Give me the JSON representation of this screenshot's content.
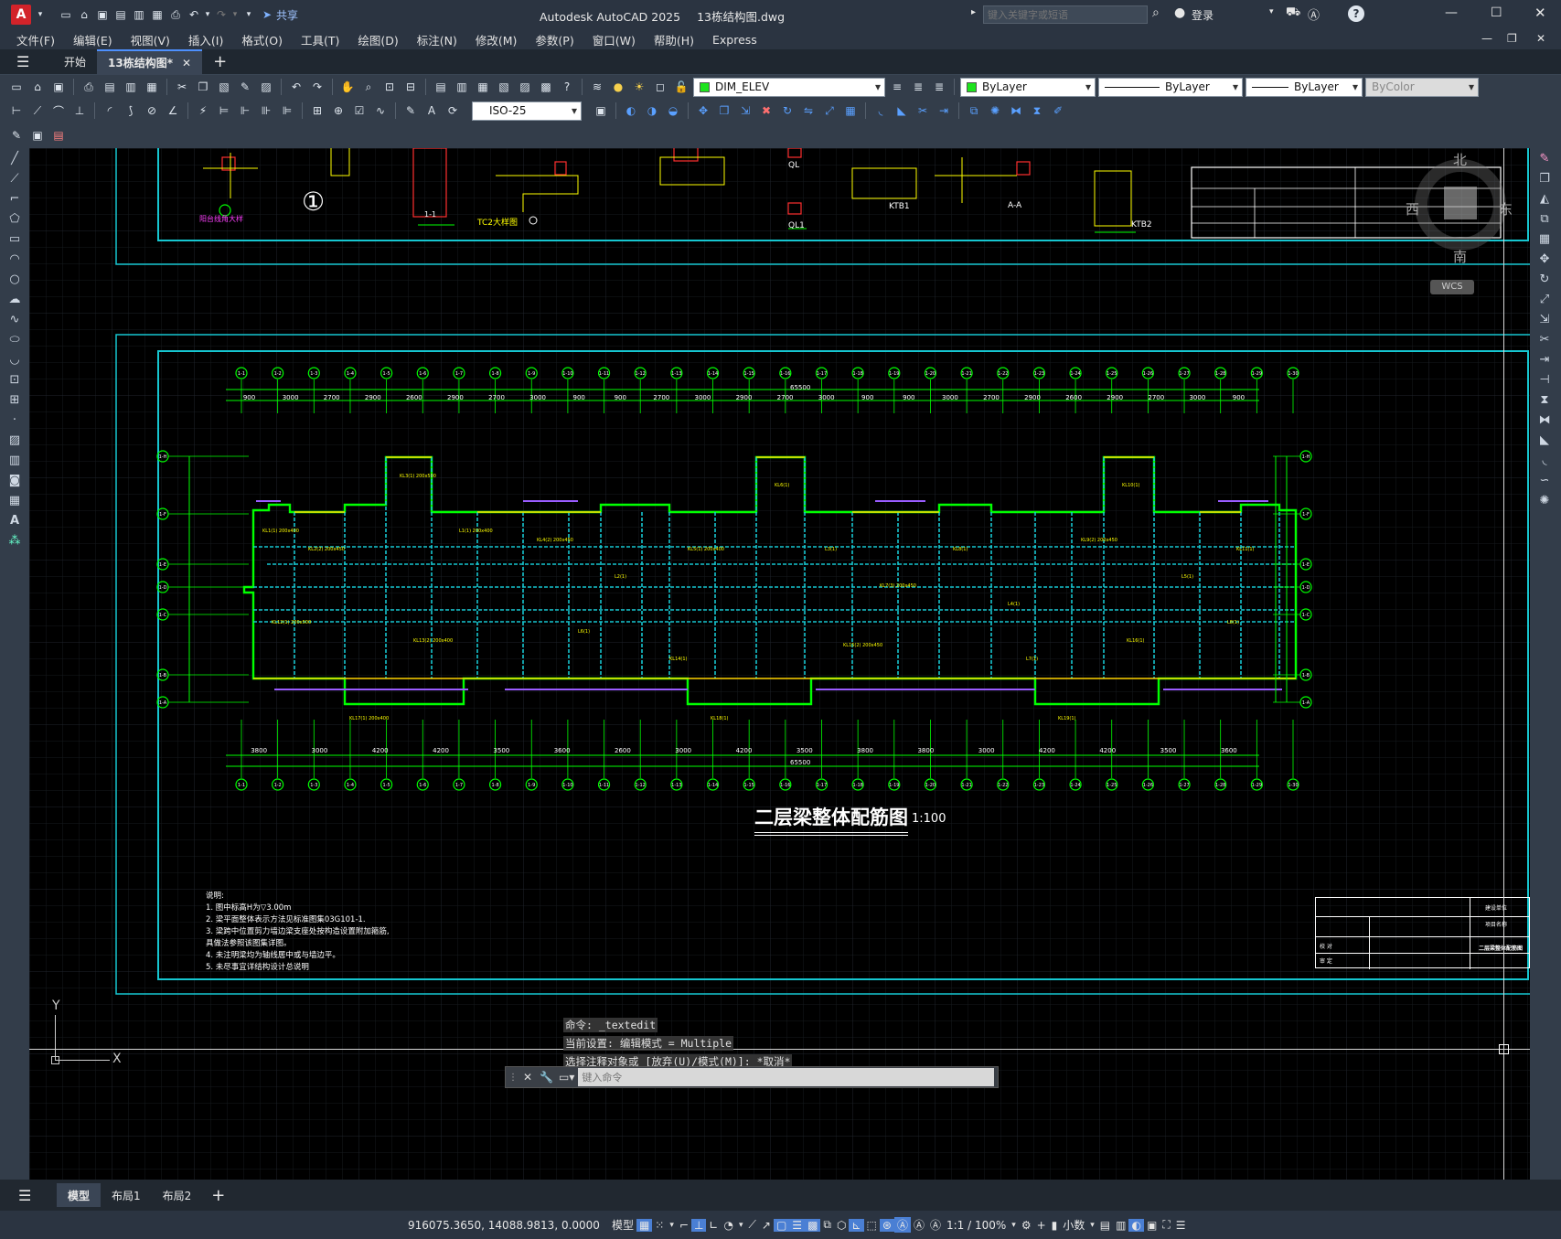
{
  "window": {
    "app_badge": "A",
    "title": "Autodesk AutoCAD 2025",
    "file": "13栋结构图.dwg",
    "search_placeholder": "键入关键字或短语",
    "login": "登录",
    "share": "共享"
  },
  "menu": [
    "文件(F)",
    "编辑(E)",
    "视图(V)",
    "插入(I)",
    "格式(O)",
    "工具(T)",
    "绘图(D)",
    "标注(N)",
    "修改(M)",
    "参数(P)",
    "窗口(W)",
    "帮助(H)",
    "Express"
  ],
  "tabs": {
    "start": "开始",
    "active": "13栋结构图*"
  },
  "toolbar": {
    "layer": "DIM_ELEV",
    "color": "ByLayer",
    "linetype": "ByLayer",
    "lineweight": "ByLayer",
    "plotstyle": "ByColor",
    "dimstyle": "ISO-25"
  },
  "drawing": {
    "title": "二层梁整体配筋图",
    "scale": "1:100",
    "total_dim": "65500",
    "notes_title": "说明:",
    "notes": [
      "1. 图中标高H为▽3.00m",
      "2. 梁平面整体表示方法见标准图集03G101-1.",
      "3. 梁跨中位置剪力墙边梁支座处按构造设置附加箍筋,",
      "   具做法参照该图集详图。",
      "4. 未注明梁均为轴线居中或与墙边平。",
      "5. 未尽事宜详结构设计总说明"
    ],
    "top_dims": [
      "900",
      "3000",
      "2700",
      "2900",
      "2600",
      "2900",
      "2700",
      "3000",
      "900",
      "900",
      "2700",
      "3000",
      "2900",
      "2700",
      "3000",
      "900",
      "900",
      "3000",
      "2700",
      "2900",
      "2600",
      "2900",
      "2700",
      "3000",
      "900"
    ],
    "bottom_dims": [
      "3800",
      "3000",
      "4200",
      "4200",
      "3500",
      "3600",
      "2600",
      "3000",
      "4200",
      "3500",
      "3800",
      "3800",
      "3000",
      "4200",
      "4200",
      "3500",
      "3600"
    ],
    "axis_top": [
      "1-1",
      "1-2",
      "1-3",
      "1-4",
      "1-5",
      "1-6",
      "1-7",
      "1-8",
      "1-9",
      "1-10",
      "1-11",
      "1-12",
      "1-13",
      "1-14",
      "1-15",
      "1-16",
      "1-17",
      "1-18",
      "1-19",
      "1-20",
      "1-21",
      "1-22",
      "1-23",
      "1-24",
      "1-25",
      "1-26",
      "1-27",
      "1-28",
      "1-29",
      "1-30"
    ],
    "axis_left": [
      "1-H",
      "1-F",
      "1-E",
      "1-D",
      "1-C",
      "1-B",
      "1-A"
    ],
    "labels_top": [
      "①",
      "阳台线角大样",
      "TC2大样图",
      "KTB1",
      "KTB2",
      "A-A",
      "QL",
      "QL1",
      "1-1"
    ],
    "compass": {
      "n": "北",
      "s": "南",
      "e": "东",
      "w": "西",
      "wcs": "WCS"
    },
    "ucs": {
      "y": "Y",
      "x": "X"
    },
    "titleblock": {
      "row1": "建设单位",
      "row2": "项目名称",
      "row3": "校 对",
      "row4": "审 定",
      "sheet": "二层梁整体配筋图"
    }
  },
  "command": {
    "line1": "命令: _textedit",
    "line2": "当前设置: 编辑模式 = Multiple",
    "line3": "选择注释对象或 [放弃(U)/模式(M)]: *取消*",
    "placeholder": "键入命令"
  },
  "layouts": [
    "模型",
    "布局1",
    "布局2"
  ],
  "status": {
    "coords": "916075.3650, 14088.9813, 0.0000",
    "mode": "模型",
    "scale": "1:1 / 100%",
    "units": "小数"
  }
}
